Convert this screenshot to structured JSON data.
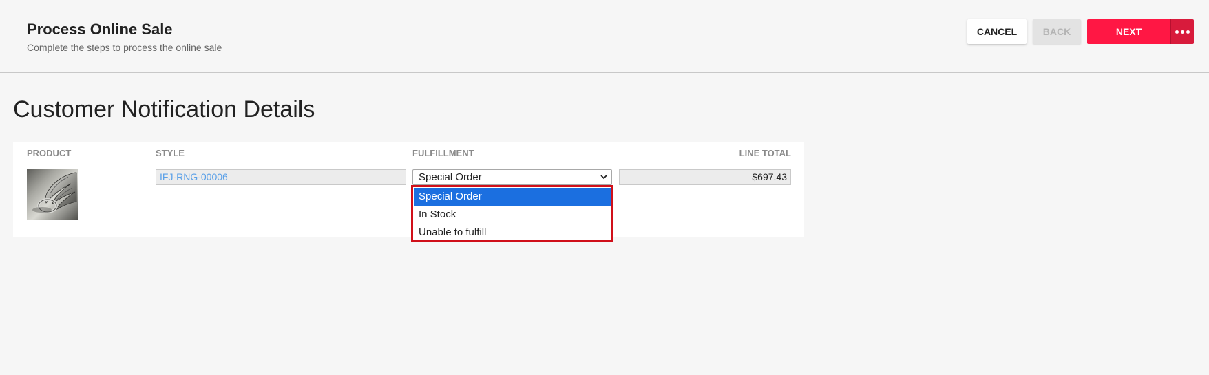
{
  "header": {
    "title": "Process Online Sale",
    "subtitle": "Complete the steps to process the online sale"
  },
  "toolbar": {
    "cancel_label": "CANCEL",
    "back_label": "BACK",
    "next_label": "NEXT",
    "more_icon": "more-horizontal-icon"
  },
  "section": {
    "title": "Customer Notification Details"
  },
  "table": {
    "columns": [
      "PRODUCT",
      "STYLE",
      "FULFILLMENT",
      "LINE TOTAL"
    ],
    "rows": [
      {
        "product_image": "winged-ring-image",
        "style": "IFJ-RNG-00006",
        "fulfillment": "Special Order",
        "line_total": "$697.43"
      }
    ]
  },
  "fulfillment_dropdown": {
    "options": [
      "Special Order",
      "In Stock",
      "Unable to fulfill"
    ],
    "selected_index": 0
  },
  "colors": {
    "accent": "#ff1744",
    "accent_dark": "#d81b3c",
    "selection": "#1b6fe0",
    "highlight_border": "#d0101a",
    "link_text": "#5aa0e8"
  }
}
